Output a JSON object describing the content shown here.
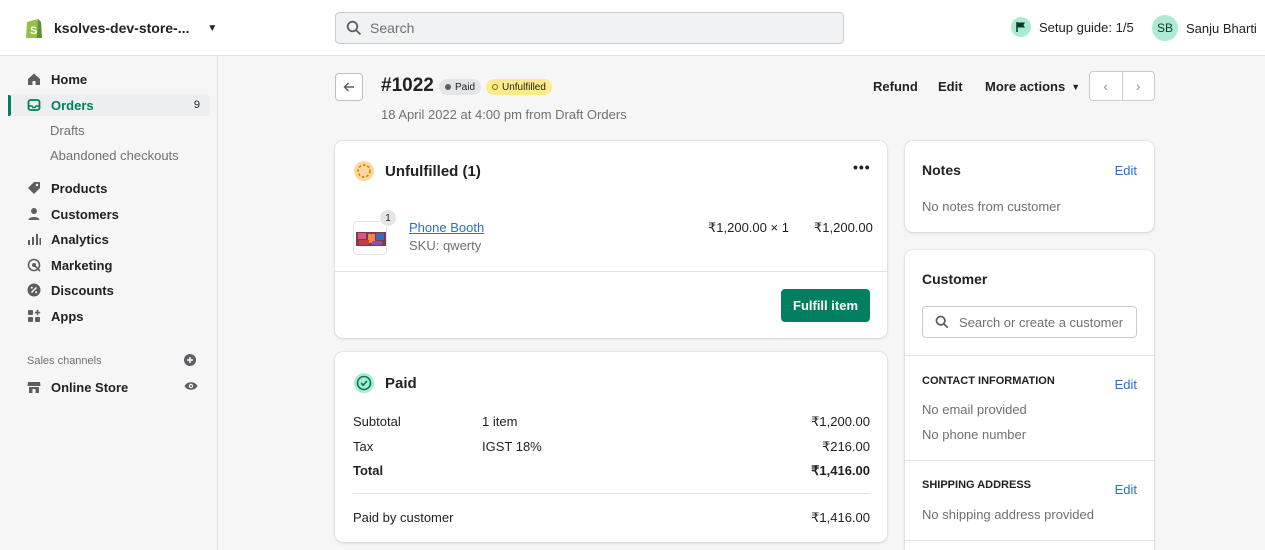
{
  "topbar": {
    "store_name": "ksolves-dev-store-...",
    "search_placeholder": "Search",
    "setup_guide": "Setup guide: 1/5",
    "user_initials": "SB",
    "user_name": "Sanju Bharti"
  },
  "sidebar": {
    "home": "Home",
    "orders": "Orders",
    "orders_count": "9",
    "drafts": "Drafts",
    "abandoned": "Abandoned checkouts",
    "products": "Products",
    "customers": "Customers",
    "analytics": "Analytics",
    "marketing": "Marketing",
    "discounts": "Discounts",
    "apps": "Apps",
    "sales_channels": "Sales channels",
    "online_store": "Online Store"
  },
  "header": {
    "order_number": "#1022",
    "paid_badge": "Paid",
    "unfulfilled_badge": "Unfulfilled",
    "subtitle": "18 April 2022 at 4:00 pm from Draft Orders",
    "refund": "Refund",
    "edit": "Edit",
    "more_actions": "More actions"
  },
  "unfulfilled": {
    "title": "Unfulfilled (1)",
    "item_name": "Phone Booth",
    "item_sku": "SKU: qwerty",
    "item_qty_badge": "1",
    "item_price_qty": "₹1,200.00 × 1",
    "item_total": "₹1,200.00",
    "fulfill_button": "Fulfill item"
  },
  "paid": {
    "title": "Paid",
    "rows": [
      {
        "label": "Subtotal",
        "detail": "1 item",
        "amount": "₹1,200.00"
      },
      {
        "label": "Tax",
        "detail": "IGST 18%",
        "amount": "₹216.00"
      },
      {
        "label": "Total",
        "detail": "",
        "amount": "₹1,416.00"
      }
    ],
    "paid_by_label": "Paid by customer",
    "paid_by_amount": "₹1,416.00"
  },
  "notes": {
    "title": "Notes",
    "edit": "Edit",
    "body": "No notes from customer"
  },
  "customer": {
    "title": "Customer",
    "search_placeholder": "Search or create a customer",
    "contact_heading": "CONTACT INFORMATION",
    "contact_edit": "Edit",
    "no_email": "No email provided",
    "no_phone": "No phone number",
    "shipping_heading": "SHIPPING ADDRESS",
    "shipping_edit": "Edit",
    "no_shipping": "No shipping address provided"
  },
  "colors": {
    "primary": "#008060",
    "link": "#2c6ecb",
    "unfulfilled_badge": "#ffea8a",
    "avatar_bg": "#aee9d1"
  }
}
